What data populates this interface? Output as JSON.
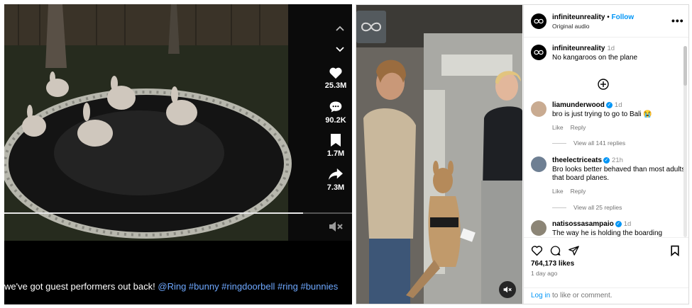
{
  "left_video": {
    "progress_fraction": 0.86,
    "actions": [
      {
        "icon": "heart-icon",
        "count": "25.3M"
      },
      {
        "icon": "comment-icon",
        "count": "90.2K"
      },
      {
        "icon": "bookmark-icon",
        "count": "1.7M"
      },
      {
        "icon": "share-icon",
        "count": "7.3M"
      }
    ],
    "caption_text": "we've got guest performers out back! ",
    "caption_tags": "@Ring #bunny #ringdoorbell #ring #bunnies"
  },
  "post": {
    "author": "infiniteunreality",
    "follow_label": "Follow",
    "audio": "Original audio",
    "caption": {
      "user": "infiniteunreality",
      "time": "1d",
      "text": "No kangaroos on the plane"
    },
    "comments": [
      {
        "user": "liamunderwood",
        "time": "1d",
        "text": "bro is just trying to go to Bali 😭",
        "like": "Like",
        "reply": "Reply",
        "view_all": "View all 141 replies"
      },
      {
        "user": "theelectriceats",
        "time": "21h",
        "text": "Bro looks better behaved than most adults that board planes.",
        "like": "Like",
        "reply": "Reply",
        "view_all": "View all 25 replies"
      },
      {
        "user": "natisossasampaio",
        "time": "1d",
        "text": "The way he is holding the boarding"
      }
    ],
    "likes": "764,173 likes",
    "posted": "1 day ago",
    "login_link": "Log in",
    "login_rest": " to like or comment."
  }
}
